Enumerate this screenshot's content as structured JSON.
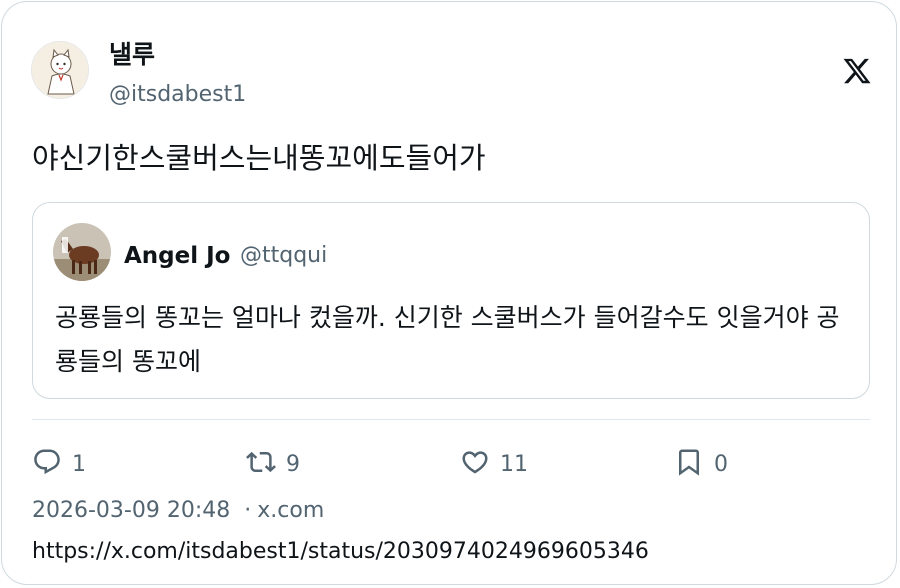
{
  "tweet": {
    "author": {
      "display_name": "낼루",
      "handle": "@itsdabest1"
    },
    "text": "야신기한스쿨버스는내똥꼬에도들어가",
    "quoted": {
      "display_name": "Angel Jo",
      "handle": "@ttqqui",
      "text": "공룡들의 똥꼬는 얼마나 컸을까. 신기한 스쿨버스가 들어갈수도 잇을거야 공룡들의 똥꼬에"
    },
    "stats": {
      "replies": "1",
      "retweets": "9",
      "likes": "11",
      "bookmarks": "0"
    },
    "timestamp": "2026-03-09 20:48",
    "separator": "·",
    "source": "x.com",
    "url": "https://x.com/itsdabest1/status/2030974024969605346"
  },
  "icons": {
    "logo": "x-logo-icon",
    "reply": "speech-bubble-icon",
    "retweet": "retweet-arrows-icon",
    "like": "heart-icon",
    "bookmark": "bookmark-icon"
  },
  "colors": {
    "text_primary": "#0f1419",
    "text_secondary": "#536471",
    "border": "#cfd9de"
  }
}
